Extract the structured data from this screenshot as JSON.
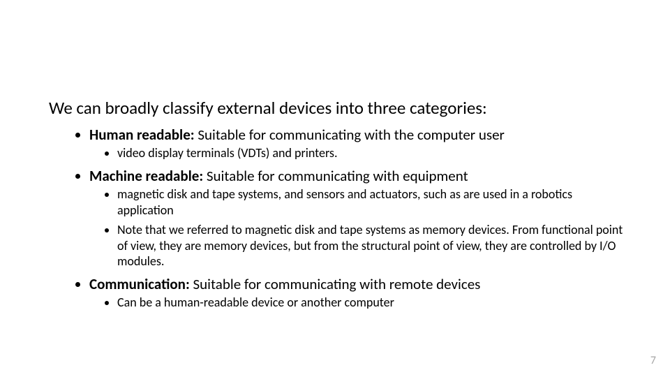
{
  "slide": {
    "intro": "We can broadly classify external devices into three categories:",
    "items": {
      "human": {
        "label": "Human readable:",
        "text": " Suitable for communicating with the computer user",
        "sub1": "video display terminals (VDTs) and printers."
      },
      "machine": {
        "label": "Machine readable:",
        "text": " Suitable for communicating with equipment",
        "sub1": "magnetic disk and tape systems, and sensors and actuators, such as are used in a robotics application",
        "sub2": "Note that we referred to magnetic disk and tape systems as memory devices. From functional point of view, they are memory devices, but from the structural point of view, they are controlled by I/O modules."
      },
      "comm": {
        "label": "Communication:",
        "text": " Suitable for communicating with remote devices",
        "sub1": "Can be a human-readable device or another computer"
      }
    },
    "page_number": "7"
  }
}
